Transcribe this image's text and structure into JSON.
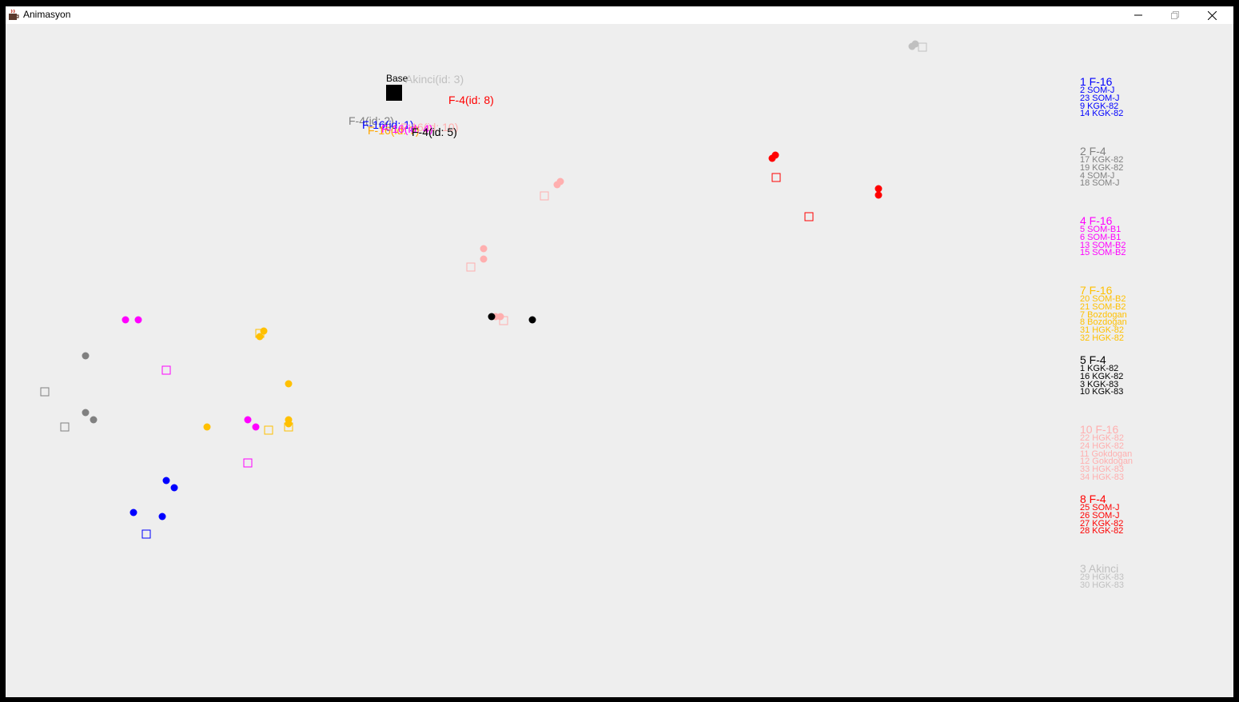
{
  "window": {
    "title": "Animasyon",
    "icon": "java-cup-icon"
  },
  "map": {
    "base_label": "Base",
    "aircraft_labels": [
      {
        "text": "Akinci(id: 3)",
        "color": "#c0c0c0"
      },
      {
        "text": "F-4(id: 8)",
        "color": "#ff0000"
      },
      {
        "text": "F-4(id: 2)",
        "color": "#808080"
      },
      {
        "text": "F-16(id: 1)",
        "color": "#0000ff"
      },
      {
        "text": "F-16(id: 10)",
        "color": "#ffafaf"
      },
      {
        "text": "F-16(id: 7)",
        "color": "#ffa500"
      },
      {
        "text": "F-16(id: 4)",
        "color": "#ff00ff"
      },
      {
        "text": "F-4(id: 5)",
        "color": "#000000"
      }
    ],
    "units": [
      {
        "color": "#c0c0c0",
        "dots": [
          [
            1134,
            28
          ],
          [
            1138,
            25
          ]
        ],
        "squares": [
          [
            1147,
            29
          ]
        ]
      },
      {
        "color": "#ff0000",
        "dots": [
          [
            959,
            168
          ],
          [
            963,
            164
          ],
          [
            1092,
            206
          ],
          [
            1092,
            214
          ]
        ],
        "squares": [
          [
            964,
            192
          ],
          [
            1005,
            241
          ]
        ]
      },
      {
        "color": "#ffafaf",
        "dots": [
          [
            690,
            201
          ],
          [
            694,
            197
          ],
          [
            598,
            281
          ],
          [
            598,
            294
          ],
          [
            613,
            366
          ],
          [
            619,
            366
          ]
        ],
        "squares": [
          [
            674,
            215
          ],
          [
            582,
            304
          ],
          [
            623,
            371
          ]
        ]
      },
      {
        "color": "#000000",
        "dots": [
          [
            608,
            366
          ],
          [
            659,
            370
          ]
        ],
        "squares": []
      },
      {
        "color": "#ff00ff",
        "dots": [
          [
            150,
            370
          ],
          [
            166,
            370
          ],
          [
            303,
            495
          ],
          [
            313,
            504
          ]
        ],
        "squares": [
          [
            201,
            433
          ],
          [
            303,
            549
          ]
        ]
      },
      {
        "color": "#808080",
        "dots": [
          [
            100,
            415
          ],
          [
            100,
            486
          ],
          [
            110,
            495
          ]
        ],
        "squares": [
          [
            49,
            460
          ],
          [
            74,
            504
          ]
        ]
      },
      {
        "color": "#ffc000",
        "dots": [
          [
            323,
            384
          ],
          [
            318,
            391
          ],
          [
            354,
            450
          ],
          [
            252,
            504
          ],
          [
            354,
            495
          ],
          [
            354,
            500
          ]
        ],
        "squares": [
          [
            318,
            387
          ],
          [
            329,
            508
          ],
          [
            354,
            504
          ]
        ]
      },
      {
        "color": "#0000ff",
        "dots": [
          [
            201,
            571
          ],
          [
            211,
            580
          ],
          [
            160,
            611
          ],
          [
            196,
            616
          ]
        ],
        "squares": [
          [
            176,
            638
          ]
        ]
      }
    ]
  },
  "legend": [
    {
      "leader": "1 F-16",
      "color": "#0000ff",
      "members": [
        "2 SOM-J",
        "23 SOM-J",
        "9 KGK-82",
        "14 KGK-82"
      ]
    },
    {
      "leader": "2 F-4",
      "color": "#808080",
      "members": [
        "17 KGK-82",
        "19 KGK-82",
        "4 SOM-J",
        "18 SOM-J"
      ]
    },
    {
      "leader": "4 F-16",
      "color": "#ff00ff",
      "members": [
        "5 SOM-B1",
        "6 SOM-B1",
        "13 SOM-B2",
        "15 SOM-B2"
      ]
    },
    {
      "leader": "7 F-16",
      "color": "#ffc000",
      "members": [
        "20 SOM-B2",
        "21 SOM-B2",
        "7 Bozdogan",
        "8 Bozdogan",
        "31 HGK-82",
        "32 HGK-82"
      ]
    },
    {
      "leader": "5 F-4",
      "color": "#000000",
      "members": [
        "1 KGK-82",
        "16 KGK-82",
        "3 KGK-83",
        "10 KGK-83"
      ]
    },
    {
      "leader": "10 F-16",
      "color": "#ffafaf",
      "members": [
        "22 HGK-82",
        "24 HGK-82",
        "11 Gokdogan",
        "12 Gokdogan",
        "33 HGK-83",
        "34 HGK-83"
      ]
    },
    {
      "leader": "8 F-4",
      "color": "#ff0000",
      "members": [
        "25 SOM-J",
        "26 SOM-J",
        "27 KGK-82",
        "28 KGK-82"
      ]
    },
    {
      "leader": "3 Akinci",
      "color": "#c0c0c0",
      "members": [
        "29 HGK-83",
        "30 HGK-83"
      ]
    }
  ]
}
